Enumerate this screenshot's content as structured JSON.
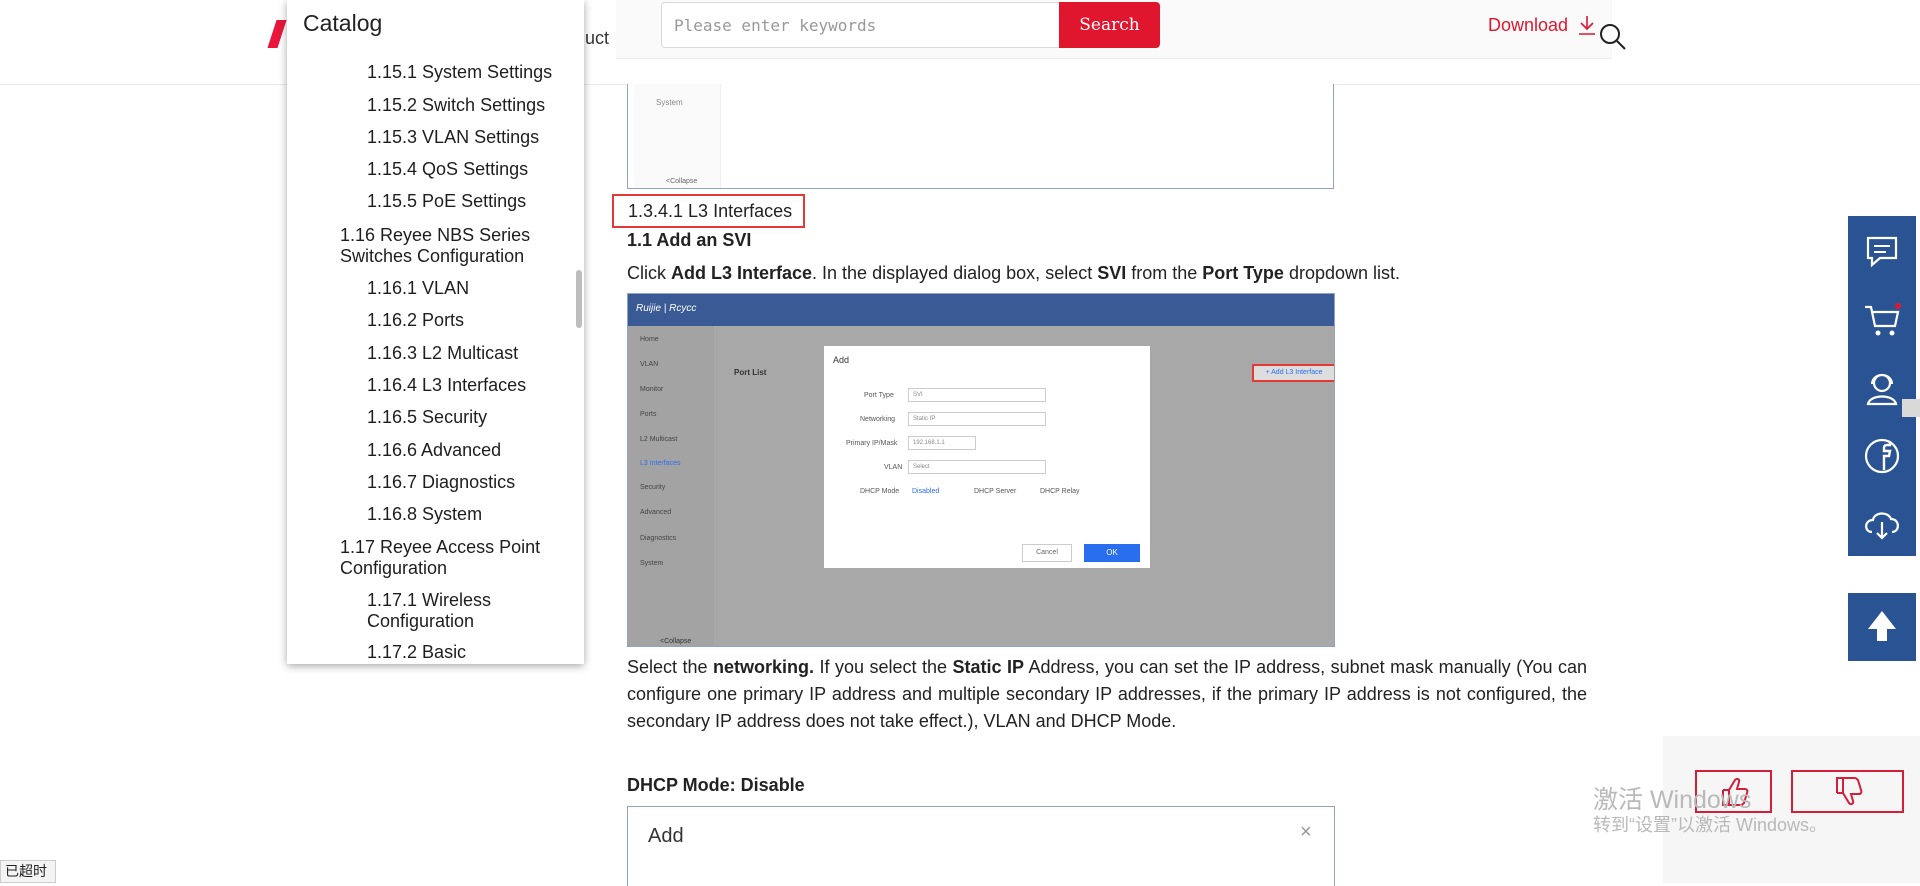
{
  "header": {
    "nav_fragment": "duct",
    "search_placeholder": "Please enter keywords",
    "search_button": "Search",
    "download_label": "Download"
  },
  "catalog": {
    "title": "Catalog",
    "items": [
      {
        "label": "1.15.1 System Settings",
        "level": 2
      },
      {
        "label": "1.15.2 Switch Settings",
        "level": 2
      },
      {
        "label": "1.15.3 VLAN Settings",
        "level": 2
      },
      {
        "label": "1.15.4 QoS Settings",
        "level": 2
      },
      {
        "label": "1.15.5 PoE Settings",
        "level": 2
      },
      {
        "label": "1.16 Reyee NBS Series Switches Configuration",
        "level": 1
      },
      {
        "label": "1.16.1 VLAN",
        "level": 2
      },
      {
        "label": "1.16.2 Ports",
        "level": 2
      },
      {
        "label": "1.16.3 L2 Multicast",
        "level": 2
      },
      {
        "label": "1.16.4 L3 Interfaces",
        "level": 2
      },
      {
        "label": "1.16.5  Security",
        "level": 2
      },
      {
        "label": "1.16.6 Advanced",
        "level": 2
      },
      {
        "label": "1.16.7 Diagnostics",
        "level": 2
      },
      {
        "label": "1.16.8 System",
        "level": 2
      },
      {
        "label": "1.17 Reyee Access Point Configuration",
        "level": 1
      },
      {
        "label": "1.17.1  Wireless Configuration",
        "level": 2
      },
      {
        "label": "1.17.2 Basic",
        "level": 2
      }
    ]
  },
  "article": {
    "shot_top": {
      "menu_item": "System",
      "collapse": "<Collapse"
    },
    "section_title": "1.3.4.1 L3 Interfaces",
    "subheading": "1.1 Add an SVI",
    "para1": {
      "t1": "Click ",
      "b1": "Add L3 Interface",
      "t2": ". In the displayed dialog box, select ",
      "b2": "SVI",
      "t3": " from the ",
      "b3": "Port Type",
      "t4": " dropdown list."
    },
    "shot_main": {
      "brand": "Ruijie | Rcycc",
      "side_items": [
        "Home",
        "VLAN",
        "Monitor",
        "Ports",
        "L2 Multicast",
        "L3 Interfaces",
        "Security",
        "Advanced",
        "Diagnostics",
        "System"
      ],
      "page_title": "Port List",
      "add_button": "+ Add L3 Interface",
      "dialog_title": "Add",
      "rows": [
        {
          "label": "Port Type",
          "value": "SVI"
        },
        {
          "label": "Networking",
          "value": "Static IP"
        },
        {
          "label": "Primary IP/Mask",
          "value": "192.168.1.1"
        },
        {
          "label": "VLAN",
          "value": "Select"
        }
      ],
      "dhcp_label": "DHCP Mode",
      "dhcp_options": [
        "Disabled",
        "DHCP Server",
        "DHCP Relay"
      ],
      "cancel": "Cancel",
      "ok": "OK",
      "collapse": "<Collapse"
    },
    "para2": {
      "t1": "Select the ",
      "b1": "networking.",
      "t2": " If you select the ",
      "b2": "Static IP",
      "t3": " Address, you can set the IP address, subnet mask manually (You can configure one primary IP address and multiple secondary IP addresses, if the primary IP address is not configured, the secondary IP address does not take effect.), VLAN and DHCP Mode."
    },
    "h4": "DHCP Mode: Disable",
    "shot_bottom": {
      "title": "Add",
      "close": "×"
    }
  },
  "watermark": {
    "line1": "激活 Windows",
    "line2": "转到“设置”以激活 Windows。"
  },
  "status": "已超时"
}
